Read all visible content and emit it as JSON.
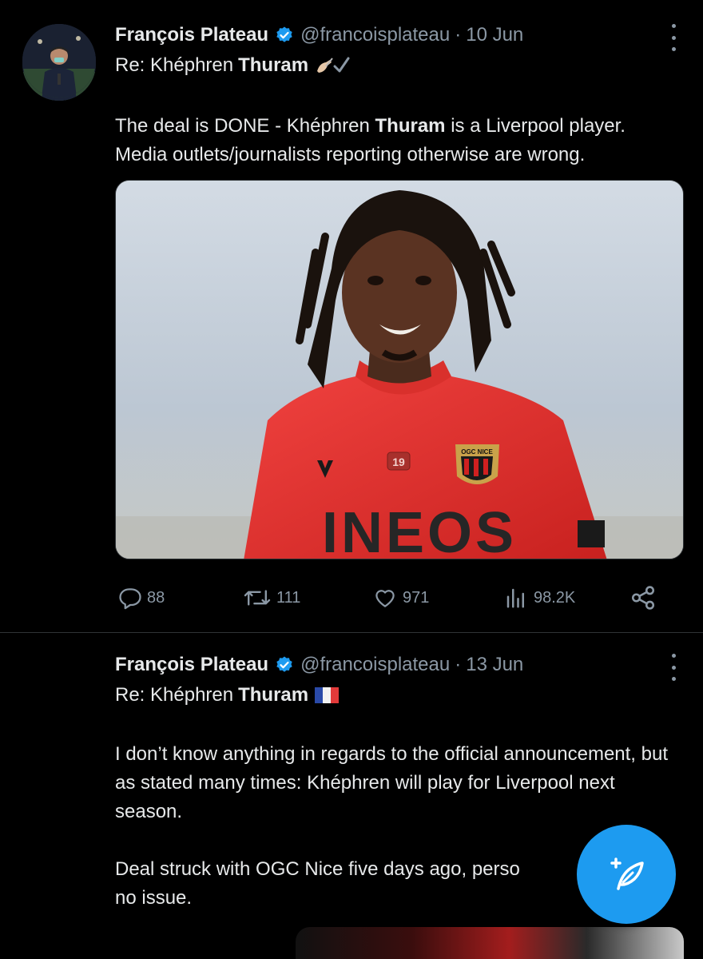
{
  "tweets": [
    {
      "author_name": "François Plateau",
      "handle": "@francoisplateau",
      "separator": "·",
      "date": "10 Jun",
      "reply_prefix": "Re: Khéphren",
      "reply_bold": "Thuram",
      "reply_emoji": "✍🏻✔️",
      "body_line1_a": "The deal is DONE - Khéphren",
      "body_line1_bold": "Thuram",
      "body_line1_b": "is a Liverpool player.",
      "body_line2": "Media outlets/journalists reporting otherwise are wrong.",
      "media_jersey_number": "19",
      "media_sponsor": "INEOS",
      "media_crest_text": "OGC NICE",
      "stats": {
        "replies": "88",
        "retweets": "111",
        "likes": "971",
        "views": "98.2K"
      }
    },
    {
      "author_name": "François Plateau",
      "handle": "@francoisplateau",
      "separator": "·",
      "date": "13 Jun",
      "reply_prefix": "Re: Khéphren",
      "reply_bold": "Thuram",
      "reply_emoji": "🇫🇷",
      "body_p1": "I don’t know anything in regards to the official announcement, but as stated many times: Khéphren will play for Liverpool next season.",
      "body_p2_visible": "Deal struck with OGC Nice five days ago, perso",
      "body_p2_line2": "no issue."
    }
  ],
  "colors": {
    "background": "#000000",
    "text": "#e7e9ea",
    "secondary": "#8b98a5",
    "accent": "#1d9bf0",
    "divider": "#2f3336"
  },
  "icons": [
    "verified-badge-icon",
    "more-vertical-icon",
    "reply-icon",
    "retweet-icon",
    "like-icon",
    "views-icon",
    "share-icon",
    "compose-icon"
  ]
}
